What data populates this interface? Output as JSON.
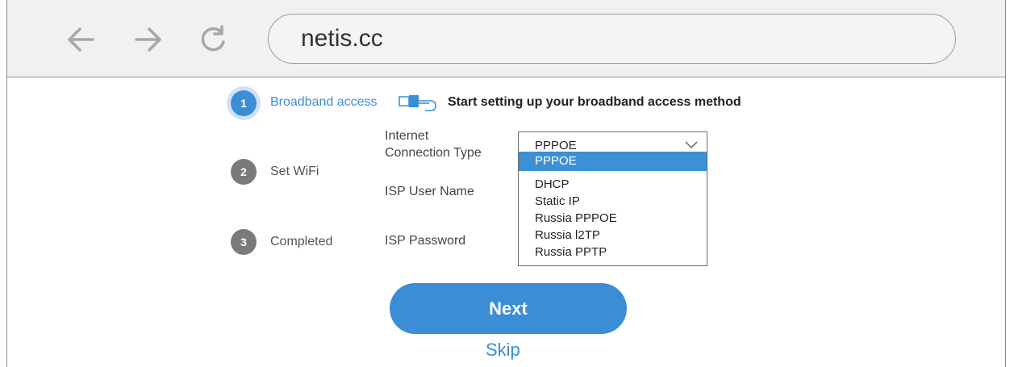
{
  "browser": {
    "url": "netis.cc",
    "back_icon": "arrow-left-icon",
    "forward_icon": "arrow-right-icon",
    "reload_icon": "reload-icon"
  },
  "steps": [
    {
      "number": "1",
      "label": "Broadband access",
      "active": true
    },
    {
      "number": "2",
      "label": "Set WiFi",
      "active": false
    },
    {
      "number": "3",
      "label": "Completed",
      "active": false
    }
  ],
  "header": {
    "icon": "ethernet-cable-icon",
    "title": "Start setting up your broadband access method"
  },
  "form": {
    "connection_type_label_line1": "Internet",
    "connection_type_label_line2": "Connection Type",
    "isp_user_label": "ISP User Name",
    "isp_password_label": "ISP Password",
    "connection_type_value": "PPPOE",
    "options": [
      "PPPOE",
      "DHCP",
      "Static IP",
      "Russia PPPOE",
      "Russia l2TP",
      "Russia PPTP"
    ]
  },
  "actions": {
    "next_label": "Next",
    "skip_label": "Skip"
  },
  "colors": {
    "accent": "#3b8dd5",
    "inactive_step": "#7a7a7a"
  }
}
